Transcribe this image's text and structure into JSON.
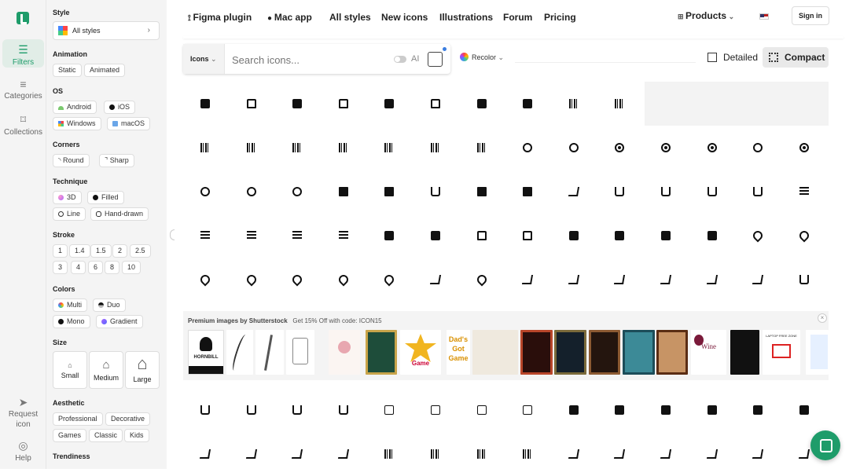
{
  "rail": {
    "filters": "Filters",
    "categories": "Categories",
    "collections": "Collections",
    "request": "Request icon",
    "help": "Help"
  },
  "sidebar": {
    "style_title": "Style",
    "style_value": "All styles",
    "animation_title": "Animation",
    "animation": [
      "Static",
      "Animated"
    ],
    "os_title": "OS",
    "os": [
      "Android",
      "iOS",
      "Windows",
      "macOS"
    ],
    "corners_title": "Corners",
    "corners": [
      "Round",
      "Sharp"
    ],
    "technique_title": "Technique",
    "technique": [
      "3D",
      "Filled",
      "Line",
      "Hand-drawn"
    ],
    "stroke_title": "Stroke",
    "stroke": [
      "1",
      "1.4",
      "1.5",
      "2",
      "2.5",
      "3",
      "4",
      "6",
      "8",
      "10"
    ],
    "colors_title": "Colors",
    "colors": [
      "Multi",
      "Duo",
      "Mono",
      "Gradient"
    ],
    "size_title": "Size",
    "sizes": [
      "Small",
      "Medium",
      "Large"
    ],
    "aesthetic_title": "Aesthetic",
    "aesthetic": [
      "Professional",
      "Decorative",
      "Games",
      "Classic",
      "Kids"
    ],
    "trendiness_title": "Trendiness"
  },
  "nav": {
    "figma": "Figma plugin",
    "mac": "Mac app",
    "all_styles": "All styles",
    "new_icons": "New icons",
    "illustrations": "Illustrations",
    "forum": "Forum",
    "pricing": "Pricing",
    "products": "Products",
    "sign_in": "Sign in"
  },
  "search": {
    "type": "Icons",
    "placeholder": "Search icons...",
    "ai_label": "AI"
  },
  "toolbar": {
    "recolor": "Recolor",
    "detailed": "Detailed",
    "compact": "Compact"
  },
  "banner": {
    "title": "Premium images by Shutterstock",
    "promo": "Get 15% Off with code: ICON15",
    "thumb_texts": [
      "HORNBILL",
      "Game",
      "Dad's Got Game",
      "Wine",
      "LAPTOP FREE ZONE"
    ]
  },
  "grid_icons": [
    "dollar-house-icon",
    "dollar-house-outline-icon",
    "dollar-house-icon",
    "dollar-house-outline-icon",
    "dollar-house-icon",
    "dollar-house-outline-icon",
    "dollar-house-icon",
    "dollar-house-icon",
    "barcode-icon",
    "barcode-icon",
    "barcode-icon",
    "barcode-icon",
    "barcode-icon",
    "barcode-icon",
    "barcode-icon",
    "barcode-icon",
    "barcode-icon",
    "rocket-icon",
    "rocket-icon",
    "target-icon",
    "target-icon",
    "target-icon",
    "search-bug-icon",
    "target-icon",
    "refresh-icon",
    "refresh-icon",
    "refresh-icon",
    "monitor-icon",
    "monitor-icon",
    "basket-icon",
    "monitor-icon",
    "monitor-icon",
    "cart-icon",
    "basket-icon",
    "basket-icon",
    "basket-icon",
    "basket-icon",
    "list-icon",
    "list-icon",
    "list-icon",
    "list-icon",
    "list-icon",
    "dollar-house-icon",
    "dollar-house-icon",
    "dollar-house-outline-icon",
    "dollar-house-outline-icon",
    "dollar-house-icon",
    "dollar-house-icon",
    "dollar-house-icon",
    "dollar-house-icon",
    "pin-icon",
    "pin-icon",
    "pin-icon",
    "pin-icon",
    "pin-icon",
    "pin-icon",
    "pin-icon",
    "cart-icon",
    "pin-icon",
    "cart-icon",
    "cart-icon",
    "cart-icon",
    "cart-icon",
    "cart-icon",
    "cart-icon",
    "basket-icon",
    "basket-icon",
    "basket-icon",
    "basket-icon",
    "basket-icon",
    "truck-icon",
    "truck-icon",
    "truck-icon",
    "truck-icon",
    "truck-icon",
    "truck-icon",
    "truck-icon",
    "truck-icon",
    "cart-icon",
    "cart-icon",
    "cart-icon",
    "cart-icon",
    "cart-icon",
    "cart-icon",
    "barcode-icon",
    "barcode-icon",
    "barcode-icon",
    "barcode-icon",
    "cart-icon",
    "cart-icon",
    "cart-icon",
    "cart-icon",
    "cart-icon",
    "cart-icon"
  ],
  "colors": {
    "brand": "#1e9c6a"
  }
}
